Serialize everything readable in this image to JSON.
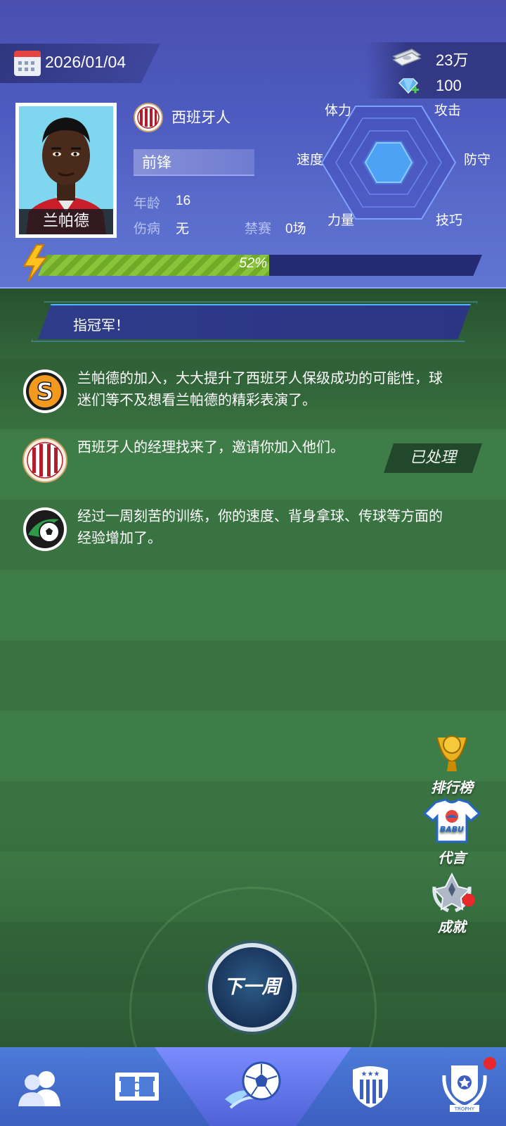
{
  "header": {
    "date": "2026/01/04",
    "money": "23万",
    "gems": "100"
  },
  "player": {
    "name": "兰帕德",
    "team": "西班牙人",
    "position": "前锋",
    "age_label": "年龄",
    "age": "16",
    "injury_label": "伤病",
    "injury": "无",
    "ban_label": "禁赛",
    "ban": "0场"
  },
  "stats": {
    "stamina": "体力",
    "attack": "攻击",
    "speed": "速度",
    "defense": "防守",
    "strength": "力量",
    "skill": "技巧"
  },
  "progress": {
    "value": 0.52,
    "label": "52%"
  },
  "banner": {
    "text": "指冠军！"
  },
  "news": [
    {
      "icon": "s-coin-icon",
      "text": "兰帕德的加入，大大提升了西班牙人保级成功的可能性，球迷们等不及想看兰帕德的精彩表演了。"
    },
    {
      "icon": "team-badge-icon",
      "text": "西班牙人的经理找来了，邀请你加入他们。",
      "action": "已处理"
    },
    {
      "icon": "football-training-icon",
      "text": "经过一周刻苦的训练，你的速度、背身拿球、传球等方面的经验增加了。"
    }
  ],
  "side_menu": {
    "ranking": "排行榜",
    "endorse": "代言",
    "achievement": "成就",
    "jersey_text": "BABU"
  },
  "next_week": "下一周",
  "nav": {
    "trophy_text": "TROPHY"
  }
}
